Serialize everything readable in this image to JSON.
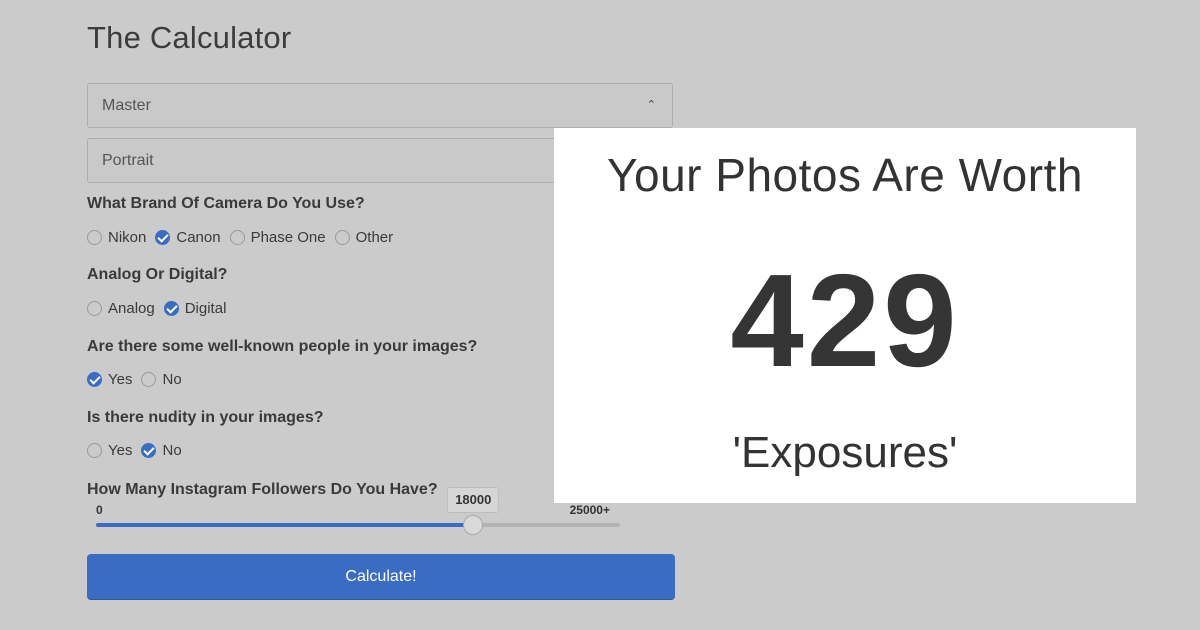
{
  "title": "The Calculator",
  "selects": [
    {
      "value": "Master"
    },
    {
      "value": "Portrait"
    }
  ],
  "questions": [
    {
      "label": "What Brand Of Camera Do You Use?",
      "options": [
        {
          "label": "Nikon",
          "checked": false
        },
        {
          "label": "Canon",
          "checked": true
        },
        {
          "label": "Phase One",
          "checked": false
        },
        {
          "label": "Other",
          "checked": false
        }
      ]
    },
    {
      "label": "Analog Or Digital?",
      "options": [
        {
          "label": "Analog",
          "checked": false
        },
        {
          "label": "Digital",
          "checked": true
        }
      ]
    },
    {
      "label": "Are there some well-known people in your images?",
      "options": [
        {
          "label": "Yes",
          "checked": true
        },
        {
          "label": "No",
          "checked": false
        }
      ]
    },
    {
      "label": "Is there nudity in your images?",
      "options": [
        {
          "label": "Yes",
          "checked": false
        },
        {
          "label": "No",
          "checked": true
        }
      ]
    }
  ],
  "slider": {
    "label": "How Many Instagram Followers Do You Have?",
    "min_label": "0",
    "max_label": "25000+",
    "min": 0,
    "max": 25000,
    "value": 18000,
    "value_label": "18000"
  },
  "button_label": "Calculate!",
  "result": {
    "heading": "Your Photos Are Worth",
    "value": "429",
    "unit": "'Exposures'"
  },
  "colors": {
    "accent": "#3b6cc4",
    "background": "#cbcbcb"
  }
}
